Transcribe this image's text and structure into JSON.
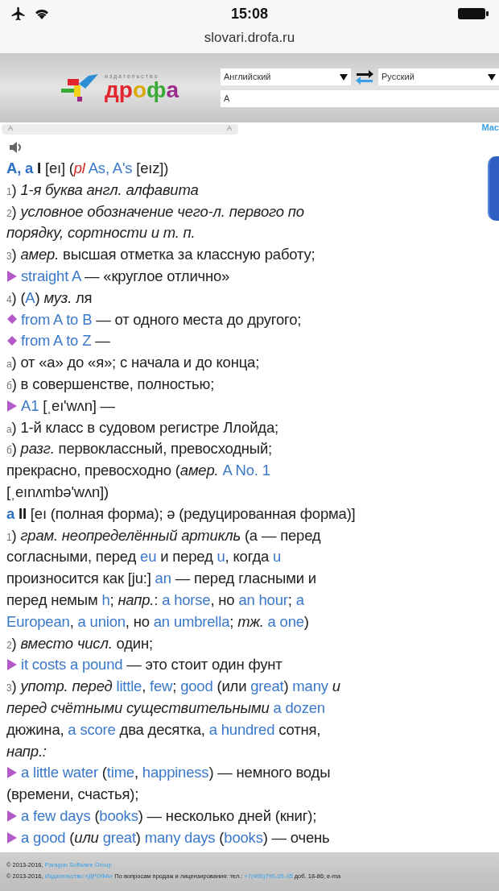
{
  "status_bar": {
    "time": "15:08"
  },
  "address_bar": {
    "url": "slovari.drofa.ru"
  },
  "header": {
    "logo": {
      "caption": "издательство",
      "letters": [
        {
          "char": "д",
          "color": "#e3262d"
        },
        {
          "char": "р",
          "color": "#e3262d"
        },
        {
          "char": "о",
          "color": "#d9a900"
        },
        {
          "char": "ф",
          "color": "#3aa935"
        },
        {
          "char": "а",
          "color": "#9b2a8c"
        }
      ]
    },
    "source_language": {
      "value": "Английский"
    },
    "target_language": {
      "value": "Русский"
    },
    "query": {
      "value": "A"
    }
  },
  "word_bar": {
    "left": "A",
    "right": "A"
  },
  "corner_link": "Мас",
  "entry": [
    {
      "parts": [
        {
          "kind": "head",
          "text": "A, a"
        },
        {
          "kind": "bold",
          "text": " I"
        },
        {
          "kind": "text",
          "text": "  [eı] ("
        },
        {
          "kind": "red",
          "text": "pl"
        },
        {
          "kind": "en",
          "text": " As, A's"
        },
        {
          "kind": "text",
          "text": " [eız])"
        }
      ]
    },
    {
      "parts": [
        {
          "kind": "num",
          "text": "1"
        },
        {
          "kind": "text",
          "text": ")"
        },
        {
          "kind": "it",
          "text": " 1-я буква англ. алфавита"
        }
      ]
    },
    {
      "parts": [
        {
          "kind": "num",
          "text": "2"
        },
        {
          "kind": "text",
          "text": ")"
        },
        {
          "kind": "it",
          "text": " условное обозначение чего-л. первого по"
        }
      ]
    },
    {
      "parts": [
        {
          "kind": "it",
          "text": "порядку, сортности и т. п."
        }
      ]
    },
    {
      "parts": [
        {
          "kind": "num",
          "text": "3"
        },
        {
          "kind": "text",
          "text": ")"
        },
        {
          "kind": "it",
          "text": " амер."
        },
        {
          "kind": "text",
          "text": " высшая отметка за классную работу;"
        }
      ]
    },
    {
      "kind": "arrow",
      "parts": [
        {
          "kind": "en",
          "text": "straight A"
        },
        {
          "kind": "text",
          "text": " — «круглое отлично»"
        }
      ]
    },
    {
      "parts": [
        {
          "kind": "num",
          "text": "4"
        },
        {
          "kind": "text",
          "text": ") ("
        },
        {
          "kind": "en",
          "text": "A"
        },
        {
          "kind": "text",
          "text": ")"
        },
        {
          "kind": "it",
          "text": " муз."
        },
        {
          "kind": "text",
          "text": " ля"
        }
      ]
    },
    {
      "kind": "diamond",
      "parts": [
        {
          "kind": "en",
          "text": "from A to B"
        },
        {
          "kind": "text",
          "text": " — от одного места до другого;"
        }
      ]
    },
    {
      "kind": "diamond",
      "parts": [
        {
          "kind": "en",
          "text": "from A to Z"
        },
        {
          "kind": "text",
          "text": " —"
        }
      ]
    },
    {
      "parts": [
        {
          "kind": "num",
          "text": "а"
        },
        {
          "kind": "text",
          "text": ") от «а» до «я»; с начала и до конца;"
        }
      ]
    },
    {
      "parts": [
        {
          "kind": "num",
          "text": "б"
        },
        {
          "kind": "text",
          "text": ") в совершенстве, полностью;"
        }
      ]
    },
    {
      "kind": "arrow",
      "parts": [
        {
          "kind": "en",
          "text": "A1"
        },
        {
          "kind": "text",
          "text": " [ˌeı'wʌn] —"
        }
      ]
    },
    {
      "parts": [
        {
          "kind": "num",
          "text": "а"
        },
        {
          "kind": "text",
          "text": ") 1-й класс в судовом регистре Ллойда;"
        }
      ]
    },
    {
      "parts": [
        {
          "kind": "num",
          "text": "б"
        },
        {
          "kind": "text",
          "text": ")"
        },
        {
          "kind": "it",
          "text": " разг."
        },
        {
          "kind": "text",
          "text": " первоклассный, превосходный;"
        }
      ]
    },
    {
      "parts": [
        {
          "kind": "text",
          "text": "прекрасно, превосходно ("
        },
        {
          "kind": "it",
          "text": "амер."
        },
        {
          "kind": "en",
          "text": " A No. 1"
        }
      ]
    },
    {
      "parts": [
        {
          "kind": "text",
          "text": "[ˌeınʌmbə'wʌn])"
        }
      ]
    },
    {
      "parts": [
        {
          "kind": "head",
          "text": "a"
        },
        {
          "kind": "bold",
          "text": " II"
        },
        {
          "kind": "text",
          "text": " [eı (полная форма); ə (редуцированная форма)]"
        }
      ]
    },
    {
      "parts": [
        {
          "kind": "num",
          "text": "1"
        },
        {
          "kind": "text",
          "text": ")"
        },
        {
          "kind": "it",
          "text": " грам. неопределённый артикль"
        },
        {
          "kind": "text",
          "text": " (a — перед"
        }
      ]
    },
    {
      "parts": [
        {
          "kind": "text",
          "text": "согласными, перед "
        },
        {
          "kind": "en",
          "text": "eu"
        },
        {
          "kind": "text",
          "text": " и перед "
        },
        {
          "kind": "en",
          "text": "u"
        },
        {
          "kind": "text",
          "text": ", когда "
        },
        {
          "kind": "en",
          "text": "u"
        }
      ]
    },
    {
      "parts": [
        {
          "kind": "text",
          "text": "произносится как [ju:] "
        },
        {
          "kind": "en",
          "text": "an"
        },
        {
          "kind": "text",
          "text": " — перед гласными и"
        }
      ]
    },
    {
      "parts": [
        {
          "kind": "text",
          "text": "перед немым "
        },
        {
          "kind": "en",
          "text": "h"
        },
        {
          "kind": "text",
          "text": ";"
        },
        {
          "kind": "it",
          "text": " напр."
        },
        {
          "kind": "text",
          "text": ": "
        },
        {
          "kind": "en",
          "text": "a horse"
        },
        {
          "kind": "text",
          "text": ", но "
        },
        {
          "kind": "en",
          "text": "an hour"
        },
        {
          "kind": "text",
          "text": ";"
        },
        {
          "kind": "en",
          "text": " a"
        }
      ]
    },
    {
      "parts": [
        {
          "kind": "en",
          "text": "European"
        },
        {
          "kind": "text",
          "text": ", "
        },
        {
          "kind": "en",
          "text": "a union"
        },
        {
          "kind": "text",
          "text": ", но "
        },
        {
          "kind": "en",
          "text": "an umbrella"
        },
        {
          "kind": "text",
          "text": ";"
        },
        {
          "kind": "it",
          "text": " тж."
        },
        {
          "kind": "en",
          "text": " a one"
        },
        {
          "kind": "text",
          "text": ")"
        }
      ]
    },
    {
      "parts": [
        {
          "kind": "num",
          "text": "2"
        },
        {
          "kind": "text",
          "text": ")"
        },
        {
          "kind": "it",
          "text": " вместо числ."
        },
        {
          "kind": "text",
          "text": " один;"
        }
      ]
    },
    {
      "kind": "arrow",
      "parts": [
        {
          "kind": "en",
          "text": "it costs a pound"
        },
        {
          "kind": "text",
          "text": " — это стоит один фунт"
        }
      ]
    },
    {
      "parts": [
        {
          "kind": "num",
          "text": "3"
        },
        {
          "kind": "text",
          "text": ")"
        },
        {
          "kind": "it",
          "text": " употр. перед"
        },
        {
          "kind": "en",
          "text": " little"
        },
        {
          "kind": "text",
          "text": ", "
        },
        {
          "kind": "en",
          "text": "few"
        },
        {
          "kind": "text",
          "text": ";"
        },
        {
          "kind": "en",
          "text": " good"
        },
        {
          "kind": "text",
          "text": " (или "
        },
        {
          "kind": "en",
          "text": "great"
        },
        {
          "kind": "text",
          "text": ")"
        },
        {
          "kind": "en",
          "text": " many"
        },
        {
          "kind": "it",
          "text": " и"
        }
      ]
    },
    {
      "parts": [
        {
          "kind": "it",
          "text": "перед счётными существительными"
        },
        {
          "kind": "en",
          "text": " a dozen"
        }
      ]
    },
    {
      "parts": [
        {
          "kind": "text",
          "text": "дюжина, "
        },
        {
          "kind": "en",
          "text": "a score"
        },
        {
          "kind": "text",
          "text": " два десятка, "
        },
        {
          "kind": "en",
          "text": "a hundred"
        },
        {
          "kind": "text",
          "text": " сотня,"
        }
      ]
    },
    {
      "parts": [
        {
          "kind": "it",
          "text": "напр.:"
        }
      ]
    },
    {
      "kind": "arrow",
      "parts": [
        {
          "kind": "en",
          "text": "a little water"
        },
        {
          "kind": "text",
          "text": " ("
        },
        {
          "kind": "en",
          "text": "time"
        },
        {
          "kind": "text",
          "text": ", "
        },
        {
          "kind": "en",
          "text": "happiness"
        },
        {
          "kind": "text",
          "text": ") — немного воды"
        }
      ]
    },
    {
      "parts": [
        {
          "kind": "text",
          "text": "(времени, счастья);"
        }
      ]
    },
    {
      "kind": "arrow",
      "parts": [
        {
          "kind": "en",
          "text": "a few days"
        },
        {
          "kind": "text",
          "text": " ("
        },
        {
          "kind": "en",
          "text": "books"
        },
        {
          "kind": "text",
          "text": ") — несколько дней (книг);"
        }
      ]
    },
    {
      "kind": "arrow",
      "parts": [
        {
          "kind": "en",
          "text": "a good"
        },
        {
          "kind": "text",
          "text": " ("
        },
        {
          "kind": "it",
          "text": "или"
        },
        {
          "kind": "en",
          "text": " great"
        },
        {
          "kind": "text",
          "text": ")"
        },
        {
          "kind": "en",
          "text": " many days"
        },
        {
          "kind": "text",
          "text": " ("
        },
        {
          "kind": "en",
          "text": "books"
        },
        {
          "kind": "text",
          "text": ") — очень"
        }
      ]
    }
  ],
  "footer": [
    {
      "parts": [
        {
          "kind": "text",
          "text": "© 2013-2016, "
        },
        {
          "kind": "link",
          "text": "Paragon Software Group"
        }
      ]
    },
    {
      "parts": [
        {
          "kind": "text",
          "text": "© 2013-2016, "
        },
        {
          "kind": "link",
          "text": "Издательство «ДРОФА»"
        },
        {
          "kind": "text",
          "text": "  По вопросам продаж и лицензирования: тел.: "
        },
        {
          "kind": "link",
          "text": "+7(495)795-05-35"
        },
        {
          "kind": "text",
          "text": " доб. 18-86; e-ma"
        }
      ]
    }
  ]
}
